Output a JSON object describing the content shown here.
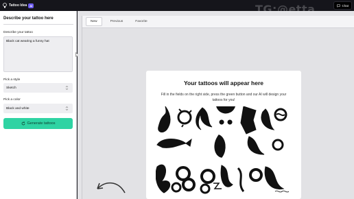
{
  "topbar": {
    "brand_title": "Tattoo Idea",
    "ai_badge": "AI",
    "chat_label": "Chat"
  },
  "watermark": "TG:@etta",
  "left_panel": {
    "title": "Describe your tattoo here",
    "describe_label": "Describe your tattoo",
    "describe_value": "Black cat wearing a funny hat",
    "style_label": "Pick a style",
    "style_value": "Sketch",
    "color_label": "Pick a color",
    "color_value": "Black and white",
    "generate_label": "Generate tattoos"
  },
  "tabs": [
    {
      "label": "New",
      "active": true
    },
    {
      "label": "Previous",
      "active": false
    },
    {
      "label": "Favorite",
      "active": false
    }
  ],
  "card": {
    "title": "Your tattoos will appear here",
    "description": "Fill in the fields on the right side, press the green button and our AI will design your tattoos for you!"
  },
  "colors": {
    "accent_green": "#2fd3a3",
    "ai_badge": "#6d5cf0",
    "topbar": "#15151b"
  },
  "icons": {
    "brand": "lightbulb-icon",
    "chat": "chat-bubble-icon",
    "generate": "refresh-icon",
    "select_chevron": "chevron-updown-icon",
    "curved_arrow": "curved-arrow-icon"
  }
}
